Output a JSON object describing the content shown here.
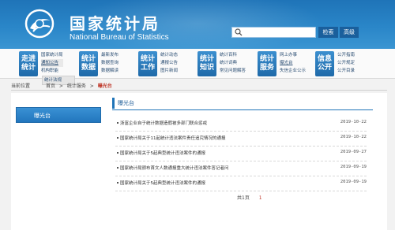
{
  "header": {
    "title_cn": "国家统计局",
    "title_en": "National Bureau of Statistics",
    "search": {
      "placeholder": "",
      "search_label": "检索",
      "advanced_label": "高级"
    }
  },
  "nav": [
    {
      "tile": [
        "走进",
        "统计"
      ],
      "links": [
        "国家统计局",
        "通知公告",
        "机构职能"
      ]
    },
    {
      "tile": [
        "统计",
        "数据"
      ],
      "links": [
        "最新发布",
        "数据查询",
        "数据解读"
      ]
    },
    {
      "tile": [
        "统计",
        "工作"
      ],
      "links": [
        "统计动态",
        "通报公告",
        "图片新闻"
      ]
    },
    {
      "tile": [
        "统计",
        "知识"
      ],
      "links": [
        "统计百科",
        "统计词典",
        "常见问题解答"
      ]
    },
    {
      "tile": [
        "统计",
        "服务"
      ],
      "links": [
        "网上办事",
        "曝光台",
        "失信企业公示"
      ]
    },
    {
      "tile": [
        "信息",
        "公开"
      ],
      "links": [
        "公开指南",
        "公开规定",
        "公开目录"
      ]
    }
  ],
  "dropdown_item": "统计法规",
  "breadcrumb": {
    "prefix": "当前位置",
    "item1": "首页",
    "item2": "统计服务",
    "current": "曝光台",
    "sep": ">"
  },
  "sidebar": {
    "title": "曝光台"
  },
  "main": {
    "title": "曝光台",
    "rows": [
      {
        "title": "浙富企业自于统计数据造假被多部门联合惩戒",
        "date": "2019-10-22"
      },
      {
        "title": "国家统计局关于11起统计违法案件责任追究情况的通报",
        "date": "2019-10-22"
      },
      {
        "title": "国家统计局关于5起典型统计违法案件的通报",
        "date": "2019-09-27"
      },
      {
        "title": "国家统计局颁布首文人数通报重大统计违法案件答记者问",
        "date": "2019-09-19"
      },
      {
        "title": "国家统计局关于5起典型统计违法案件的通报",
        "date": "2019-09-19"
      }
    ],
    "pager": {
      "total": "共1页",
      "current": "1"
    }
  }
}
